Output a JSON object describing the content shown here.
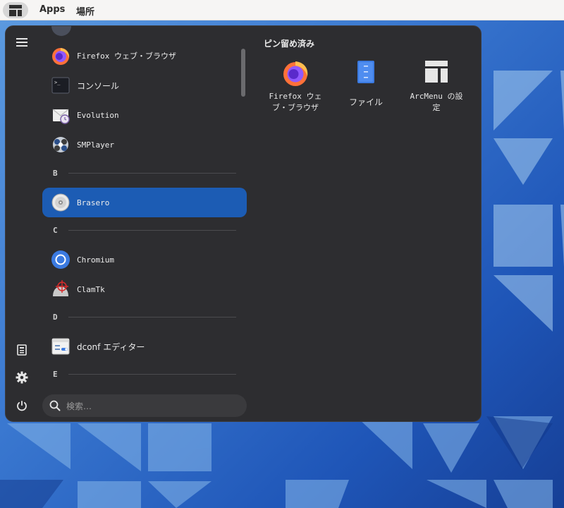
{
  "topbar": {
    "arcmenu_icon": "arcmenu-layout-icon",
    "apps_label": "Apps",
    "places_label": "場所"
  },
  "sidebar": {
    "items": [
      {
        "icon": "hamburger-menu-icon"
      },
      {
        "icon": "documents-icon"
      },
      {
        "icon": "settings-gear-icon"
      },
      {
        "icon": "power-icon"
      }
    ]
  },
  "app_list": {
    "rows": [
      {
        "label": "Firefox ウェブ・ブラウザ",
        "icon": "firefox-icon"
      },
      {
        "label": "コンソール",
        "icon": "terminal-icon"
      },
      {
        "label": "Evolution",
        "icon": "evolution-icon"
      },
      {
        "label": "SMPlayer",
        "icon": "smplayer-icon"
      },
      {
        "label": "Brasero",
        "icon": "brasero-disc-icon"
      },
      {
        "label": "Chromium",
        "icon": "chromium-icon"
      },
      {
        "label": "ClamTk",
        "icon": "clamtk-icon"
      },
      {
        "label": "dconf エディター",
        "icon": "dconf-editor-icon"
      }
    ],
    "sections": [
      "B",
      "C",
      "D",
      "E"
    ],
    "selected": "Brasero"
  },
  "search": {
    "placeholder": "検索…",
    "icon": "search-icon"
  },
  "pinned": {
    "title": "ピン留め済み",
    "items": [
      {
        "label_line1": "Firefox ウェ",
        "label_line2": "ブ・ブラウザ",
        "icon": "firefox-icon"
      },
      {
        "label_line1": "ファイル",
        "label_line2": "",
        "icon": "files-icon"
      },
      {
        "label_line1": "ArcMenu の設",
        "label_line2": "定",
        "icon": "arcmenu-settings-icon"
      }
    ]
  },
  "colors": {
    "menu_bg": "#2d2d30",
    "selected_bg": "#1c5cb4",
    "topbar_bg": "#f6f5f4",
    "wallpaper_blue": "#3a78d0"
  }
}
